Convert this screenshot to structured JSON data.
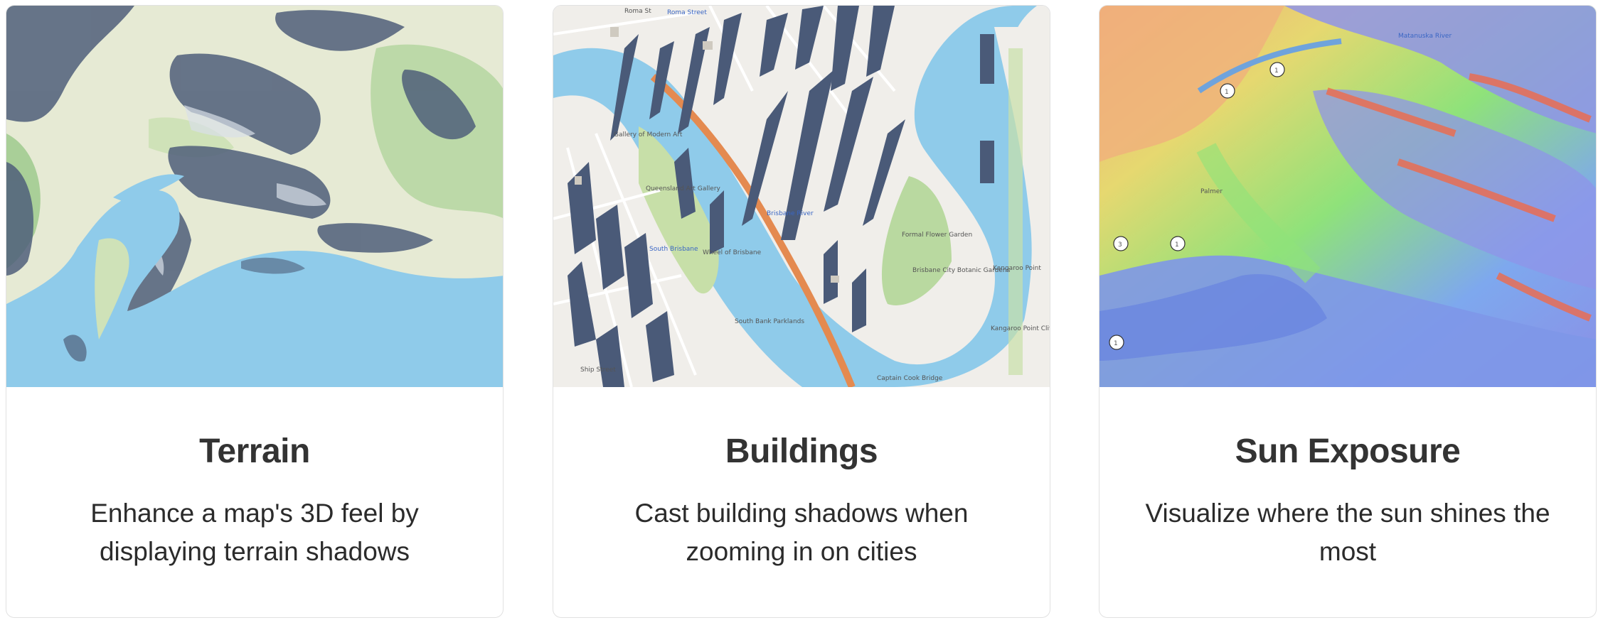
{
  "cards": [
    {
      "title": "Terrain",
      "description": "Enhance a map's 3D feel by displaying terrain shadows",
      "image": "terrain-hillshade-map"
    },
    {
      "title": "Buildings",
      "description": "Cast building shadows when zooming in on cities",
      "image": "building-shadows-map",
      "map_labels": [
        "Roma St",
        "Roma Street",
        "Gallery of Modern Art",
        "Queensland Art Gallery",
        "South Brisbane",
        "Wheel of Brisbane",
        "South Bank Parklands",
        "Formal Flower Garden",
        "Brisbane City Botanic Gardens",
        "Kangaroo Point",
        "Kangaroo Point Cliffs",
        "Captain Cook Bridge",
        "Brisbane River",
        "Ship Street"
      ]
    },
    {
      "title": "Sun Exposure",
      "description": "Visualize where the sun shines the most",
      "image": "sun-exposure-map",
      "map_labels": [
        "Palmer",
        "Matanuska River",
        "1",
        "1",
        "1",
        "1",
        "3"
      ]
    }
  ],
  "colors": {
    "water": "#8fcbea",
    "land": "#e8ecd6",
    "shadow": "#4a5a78",
    "border": "#e1e1e1",
    "text": "#333333"
  }
}
